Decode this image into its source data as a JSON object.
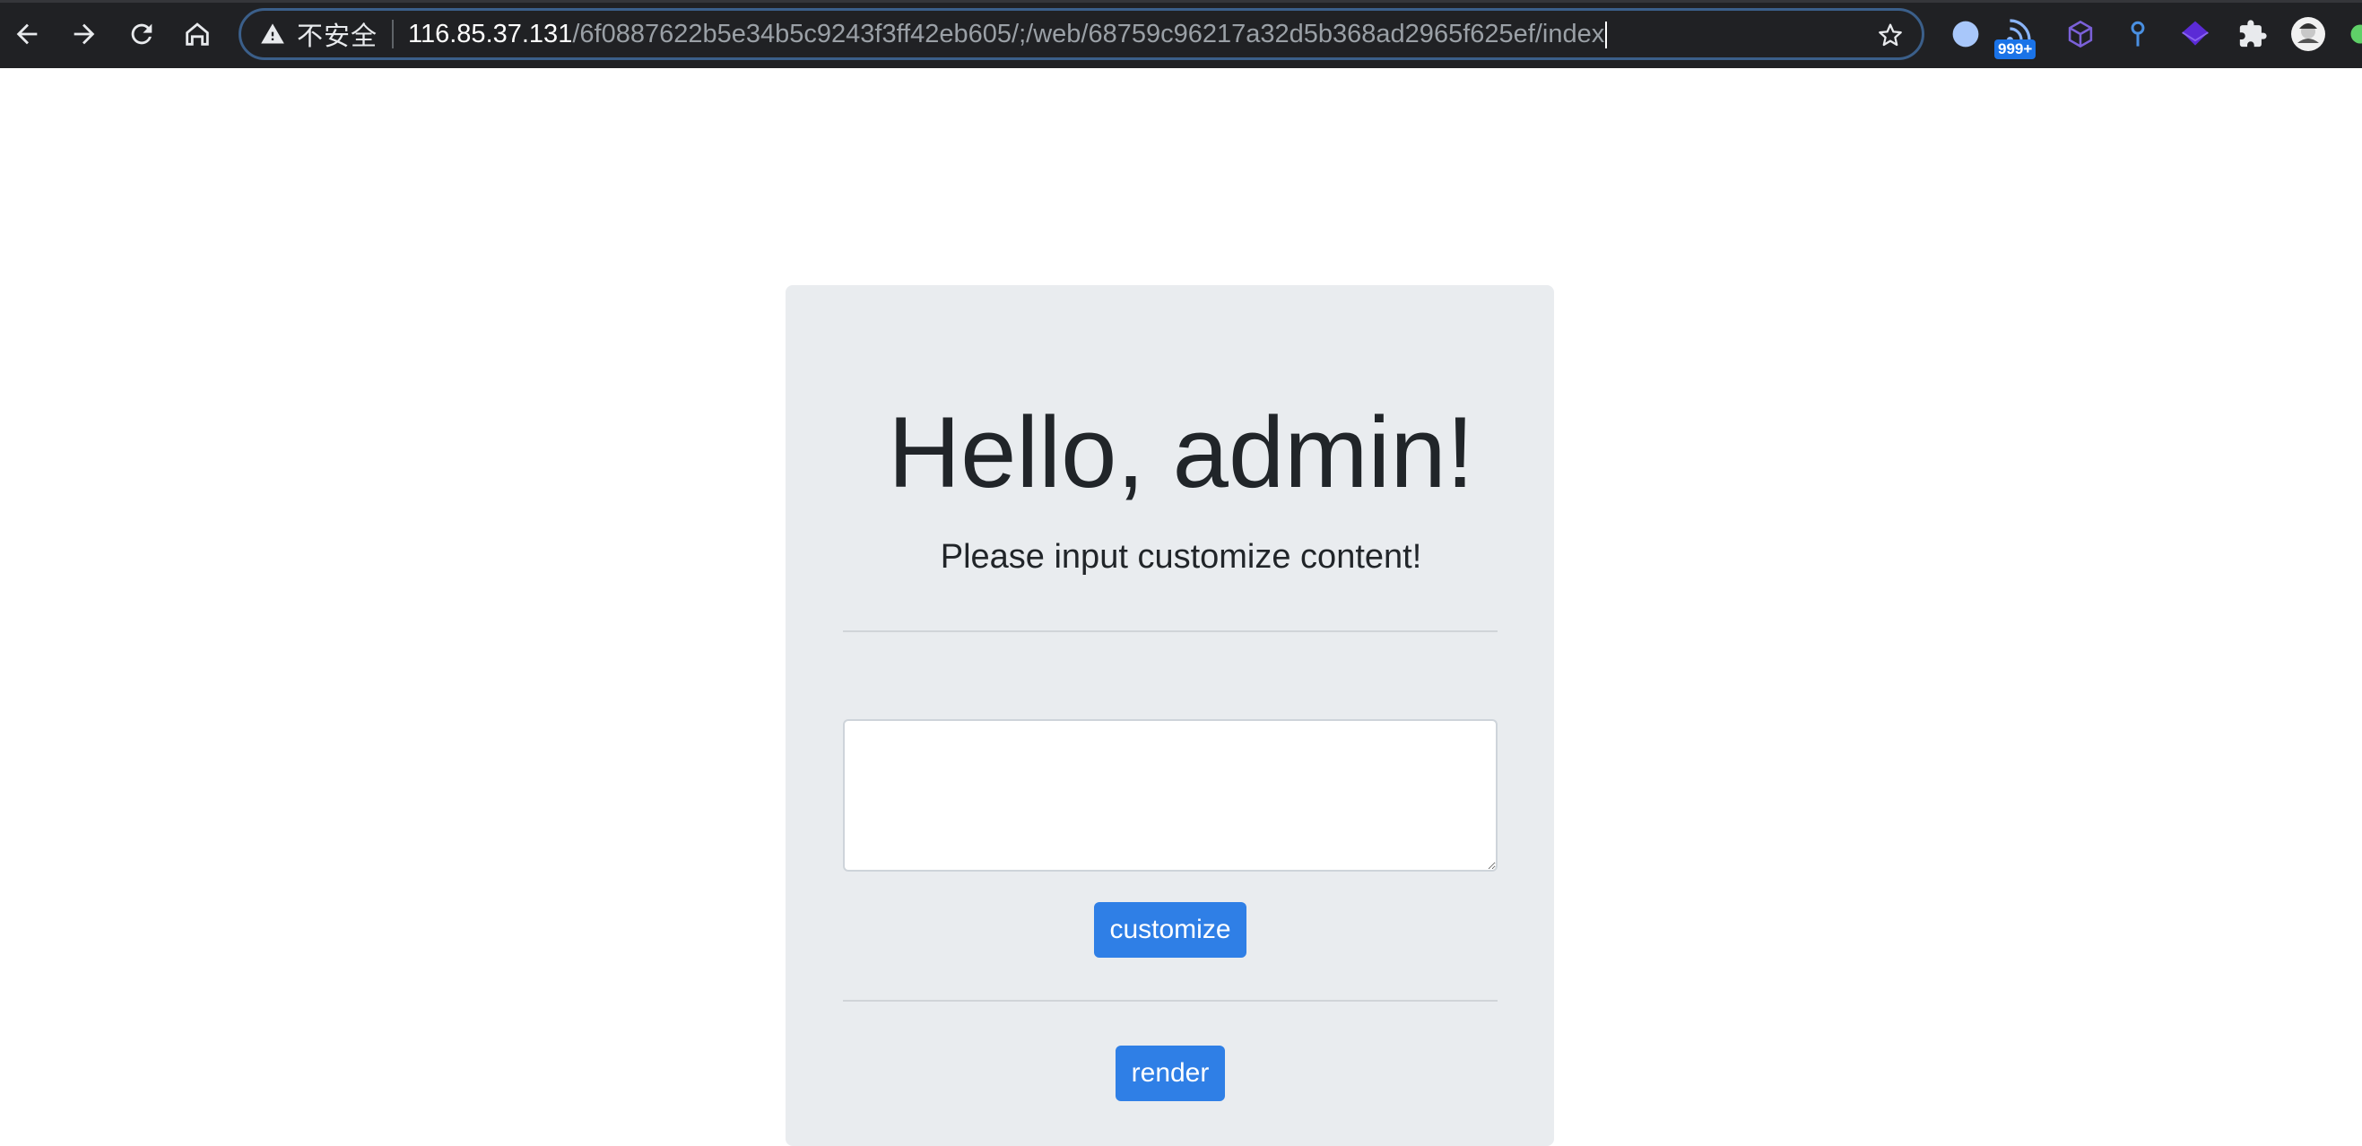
{
  "browser": {
    "insecure_label": "不安全",
    "url_host": "116.85.37.131",
    "url_path": "/6f0887622b5e34b5c9243f3ff42eb605/;/web/68759c96217a32d5b368ad2965f625ef/index",
    "extension_badge": "999+",
    "icons": [
      "back-arrow-icon",
      "forward-arrow-icon",
      "reload-icon",
      "home-icon",
      "warning-icon",
      "star-icon",
      "extension-puzzle-icon",
      "profile-avatar-icon"
    ]
  },
  "page": {
    "title": "Hello, admin!",
    "subtitle": "Please input customize content!",
    "textarea_value": "",
    "customize_label": "customize",
    "render_label": "render"
  },
  "colors": {
    "toolbar_bg": "#202124",
    "card_bg": "#e9ecef",
    "button_bg": "#2f7fe6"
  }
}
